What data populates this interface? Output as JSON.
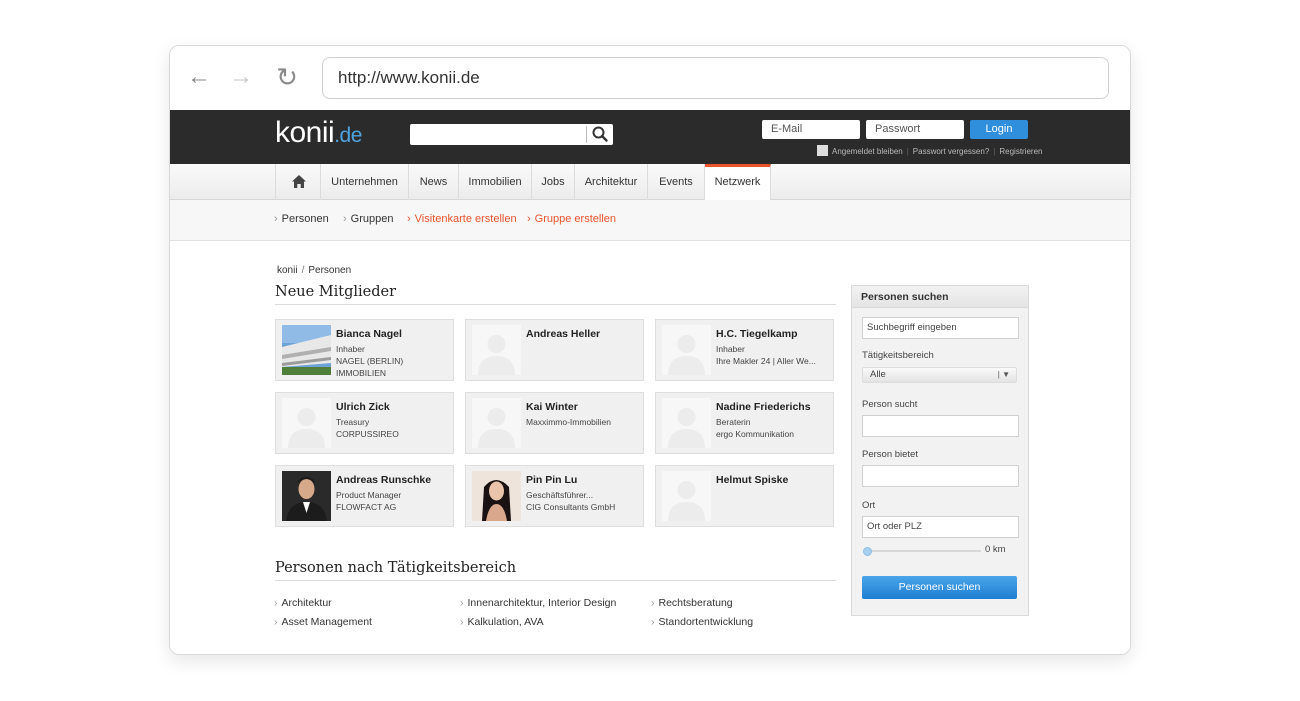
{
  "browser": {
    "url": "http://www.konii.de",
    "back_icon": "←",
    "forward_icon": "→",
    "reload_icon": "↻"
  },
  "header": {
    "logo_main": "konii",
    "logo_tld": ".de",
    "search_placeholder": "",
    "email_placeholder": "E-Mail",
    "password_placeholder": "Passwort",
    "login_label": "Login",
    "remember_label": "Angemeldet bleiben",
    "forgot_label": "Passwort vergessen?",
    "register_label": "Registrieren",
    "separator": "|"
  },
  "nav": {
    "items": [
      {
        "label": "Unternehmen"
      },
      {
        "label": "News"
      },
      {
        "label": "Immobilien"
      },
      {
        "label": "Jobs"
      },
      {
        "label": "Architektur"
      },
      {
        "label": "Events"
      },
      {
        "label": "Netzwerk",
        "active": true
      }
    ]
  },
  "subnav": {
    "caret": "›",
    "items": [
      {
        "label": "Personen"
      },
      {
        "label": "Gruppen"
      },
      {
        "label": "Visitenkarte erstellen"
      },
      {
        "label": "Gruppe erstellen"
      }
    ]
  },
  "breadcrumb": {
    "root": "konii",
    "separator": "/",
    "current": "Personen"
  },
  "members": {
    "title": "Neue Mitglieder",
    "cards": [
      {
        "name": "Bianca Nagel",
        "lines": [
          "Inhaber",
          "NAGEL (BERLIN)",
          "IMMOBILIEN"
        ],
        "photo": "building"
      },
      {
        "name": "Andreas Heller",
        "lines": [],
        "photo": "placeholder"
      },
      {
        "name": "H.C. Tiegelkamp",
        "lines": [
          "Inhaber",
          "Ihre Makler 24 | Aller We..."
        ],
        "photo": "placeholder"
      },
      {
        "name": "Ulrich Zick",
        "lines": [
          "Treasury",
          "CORPUSSIREO"
        ],
        "photo": "placeholder"
      },
      {
        "name": "Kai Winter",
        "lines": [
          "Maxximmo-Immobilien"
        ],
        "photo": "placeholder"
      },
      {
        "name": "Nadine Friederichs",
        "lines": [
          "Beraterin",
          "ergo Kommunikation"
        ],
        "photo": "placeholder"
      },
      {
        "name": "Andreas Runschke",
        "lines": [
          "Product Manager",
          "FLOWFACT AG"
        ],
        "photo": "man"
      },
      {
        "name": "Pin Pin Lu",
        "lines": [
          "Geschäftsführer...",
          "CIG Consultants GmbH"
        ],
        "photo": "woman"
      },
      {
        "name": "Helmut Spiske",
        "lines": [],
        "photo": "placeholder"
      }
    ]
  },
  "categories": {
    "title": "Personen nach Tätigkeitsbereich",
    "caret": "›",
    "items": [
      {
        "label": "Architektur"
      },
      {
        "label": "Innenarchitektur, Interior Design"
      },
      {
        "label": "Rechtsberatung"
      },
      {
        "label": "Asset Management"
      },
      {
        "label": "Kalkulation, AVA"
      },
      {
        "label": "Standortentwicklung"
      }
    ]
  },
  "sidebar": {
    "title": "Personen suchen",
    "search_placeholder": "Suchbegriff eingeben",
    "field_label": "Tätigkeitsbereich",
    "field_value": "Alle",
    "field_arrow": "| ▼",
    "seeks_label": "Person sucht",
    "offers_label": "Person bietet",
    "location_label": "Ort",
    "location_placeholder": "Ort oder PLZ",
    "radius": "0 km",
    "radius_value": 0,
    "button_label": "Personen suchen"
  },
  "colors": {
    "accent_orange": "#e8542c",
    "button_blue": "#2f8fdc",
    "topbar": "#2b2b2b",
    "logo_blue": "#4fa3e0"
  }
}
